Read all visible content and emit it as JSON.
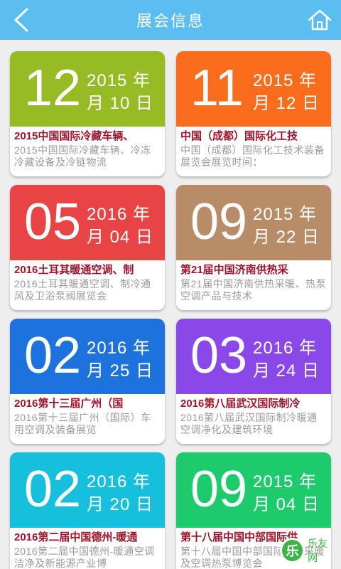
{
  "header": {
    "title": "展会信息",
    "back_icon": "chevron-left-icon",
    "home_icon": "home-icon"
  },
  "colors": {
    "header_bg": "#5bbdf0",
    "title_red": "#a0142a"
  },
  "exhibitions": [
    {
      "day": "12",
      "year": "2015 年",
      "month": "月 10 日",
      "name": "2015中国国际冷藏车辆、",
      "desc": "2015中国国际冷藏车辆、冷冻冷藏设备及冷链物流",
      "color": "#97bb25"
    },
    {
      "day": "11",
      "year": "2015 年",
      "month": "月 12 日",
      "name": "中国（成都）国际化工技",
      "desc": "中国（成都）国际化工技术装备展览会展览时间：",
      "color": "#fb6c1c"
    },
    {
      "day": "05",
      "year": "2016 年",
      "month": "月 04 日",
      "name": "2016土耳其暖通空调、制",
      "desc": "2016土耳其暖通空调、制冷通风及卫浴泵阀展览会",
      "color": "#e84445"
    },
    {
      "day": "09",
      "year": "2015 年",
      "month": "月 22 日",
      "name": "第21届中国济南供热采",
      "desc": "第21届中国济南供热采暖、热泵空调产品与技术",
      "color": "#b88c66"
    },
    {
      "day": "02",
      "year": "2016 年",
      "month": "月 25 日",
      "name": "2016第十三届广州（国",
      "desc": "2016第十三届广州（国际）车用空调及装备展览",
      "color": "#1e72dc"
    },
    {
      "day": "03",
      "year": "2016 年",
      "month": "月 24 日",
      "name": "2016第八届武汉国际制冷",
      "desc": "2016第八届武汉国际制冷暖通空调净化及建筑环境",
      "color": "#8a48e8"
    },
    {
      "day": "02",
      "year": "2016 年",
      "month": "月 20 日",
      "name": "2016第二届中国德州-暖通",
      "desc": "2016第二届中国德州-暖通空调洁净及新能源产业博",
      "color": "#16bfdb"
    },
    {
      "day": "09",
      "year": "2015 年",
      "month": "月 04 日",
      "name": "第十八届中国中部国际供",
      "desc": "第十八届中国中部国际供热采暖及空调热泵博览会",
      "color": "#1ecb6c"
    }
  ],
  "watermark": {
    "icon": "leyou-logo-icon",
    "text": "乐友网"
  }
}
